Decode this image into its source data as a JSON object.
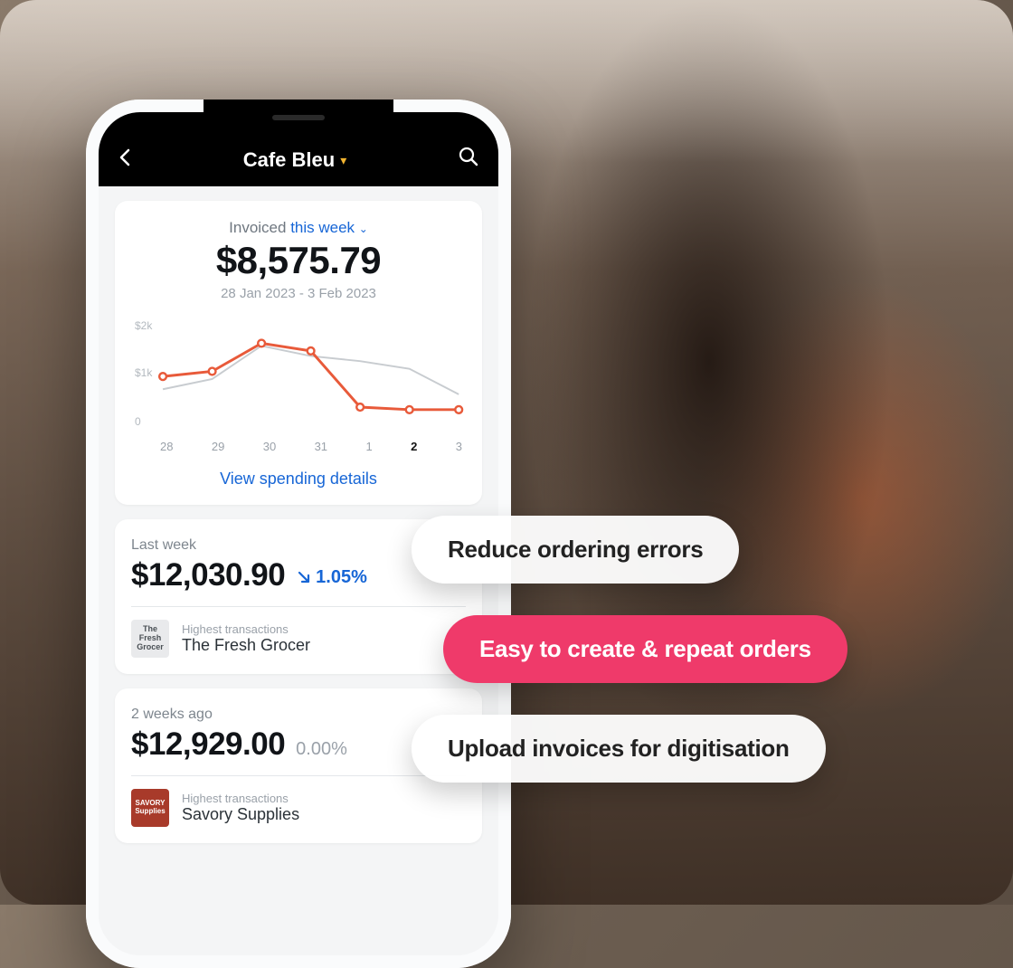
{
  "header": {
    "title": "Cafe Bleu"
  },
  "invoiced": {
    "label_prefix": "Invoiced ",
    "period_label": "this week",
    "amount": "$8,575.79",
    "date_range": "28 Jan 2023 - 3 Feb 2023",
    "view_details": "View spending details"
  },
  "chart_data": {
    "type": "line",
    "x": [
      "28",
      "29",
      "30",
      "31",
      "1",
      "2",
      "3"
    ],
    "active_index": 5,
    "series": [
      {
        "name": "current",
        "color": "#e85a3a",
        "values": [
          950,
          1050,
          1600,
          1450,
          350,
          300,
          300
        ]
      },
      {
        "name": "previous",
        "color": "#c8ccd0",
        "values": [
          700,
          900,
          1550,
          1350,
          1250,
          1100,
          600
        ]
      }
    ],
    "y_ticks": [
      "$2k",
      "$1k",
      "0"
    ],
    "ylim": [
      0,
      2000
    ]
  },
  "periods": [
    {
      "label": "Last week",
      "amount": "$12,030.90",
      "delta": "1.05%",
      "delta_direction": "down",
      "highest_label": "Highest transactions",
      "supplier": "The Fresh Grocer",
      "logo_text": "The Fresh Grocer",
      "logo_style": "fresh"
    },
    {
      "label": "2 weeks ago",
      "amount": "$12,929.00",
      "delta": "0.00%",
      "delta_direction": "none",
      "highest_label": "Highest transactions",
      "supplier": "Savory Supplies",
      "logo_text": "SAVORY Supplies",
      "logo_style": "savory"
    }
  ],
  "pills": [
    {
      "text": "Reduce ordering errors",
      "style": "white"
    },
    {
      "text": "Easy to create & repeat orders",
      "style": "pink"
    },
    {
      "text": "Upload invoices for digitisation",
      "style": "white"
    }
  ]
}
